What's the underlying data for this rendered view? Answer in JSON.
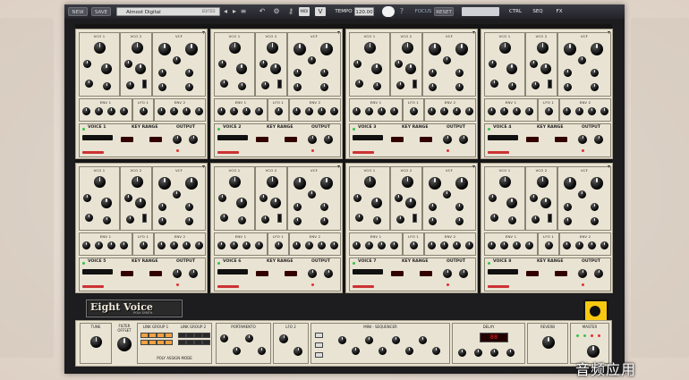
{
  "toolbar": {
    "new_label": "NEW",
    "save_label": "SAVE",
    "preset_name": "Almost Digital",
    "preset_tag": "EDITED",
    "tempo_label": "TEMPO",
    "tempo_value": "120.00",
    "focus_label": "FOCUS",
    "reset_label": "RESET",
    "ctrl_label": "CTRL",
    "seq_label": "SEQ",
    "fx_label": "FX"
  },
  "voices": [
    {
      "label": "VOICE 1"
    },
    {
      "label": "VOICE 2"
    },
    {
      "label": "VOICE 3"
    },
    {
      "label": "VOICE 4"
    },
    {
      "label": "VOICE 5"
    },
    {
      "label": "VOICE 6"
    },
    {
      "label": "VOICE 7"
    },
    {
      "label": "VOICE 8"
    }
  ],
  "module_labels": {
    "vco1": "VCO 1",
    "vco2": "VCO 2",
    "vcf": "VCF",
    "env1": "ENV 1",
    "lfo1": "LFO 1",
    "env2": "ENV 2",
    "key_range": "KEY RANGE",
    "output": "OUTPUT"
  },
  "brand": {
    "title": "Eight Voice",
    "subtitle": "POLY SYNTH"
  },
  "bottom": {
    "tune": "TUNE",
    "filter_offset": "FILTER OFFSET",
    "link_group_1": "LINK GROUP 1",
    "link_group_2": "LINK GROUP 2",
    "poly_assign": "POLY ASSIGN MODE",
    "portamento": "PORTAMENTO",
    "lfo2": "LFO 2",
    "mini_sequencer": "MINI - SEQUENCER",
    "delay": "DELAY",
    "reverb": "REVERB",
    "master": "MASTER"
  },
  "watermark": "音频应用",
  "colors": {
    "panel": "#e9e3d3",
    "rack": "#151515",
    "toolbar": "#2b2c33",
    "led_green": "#35c24a",
    "led_red": "#e03030",
    "pad_orange": "#f0a040",
    "badge": "#f7c812"
  }
}
